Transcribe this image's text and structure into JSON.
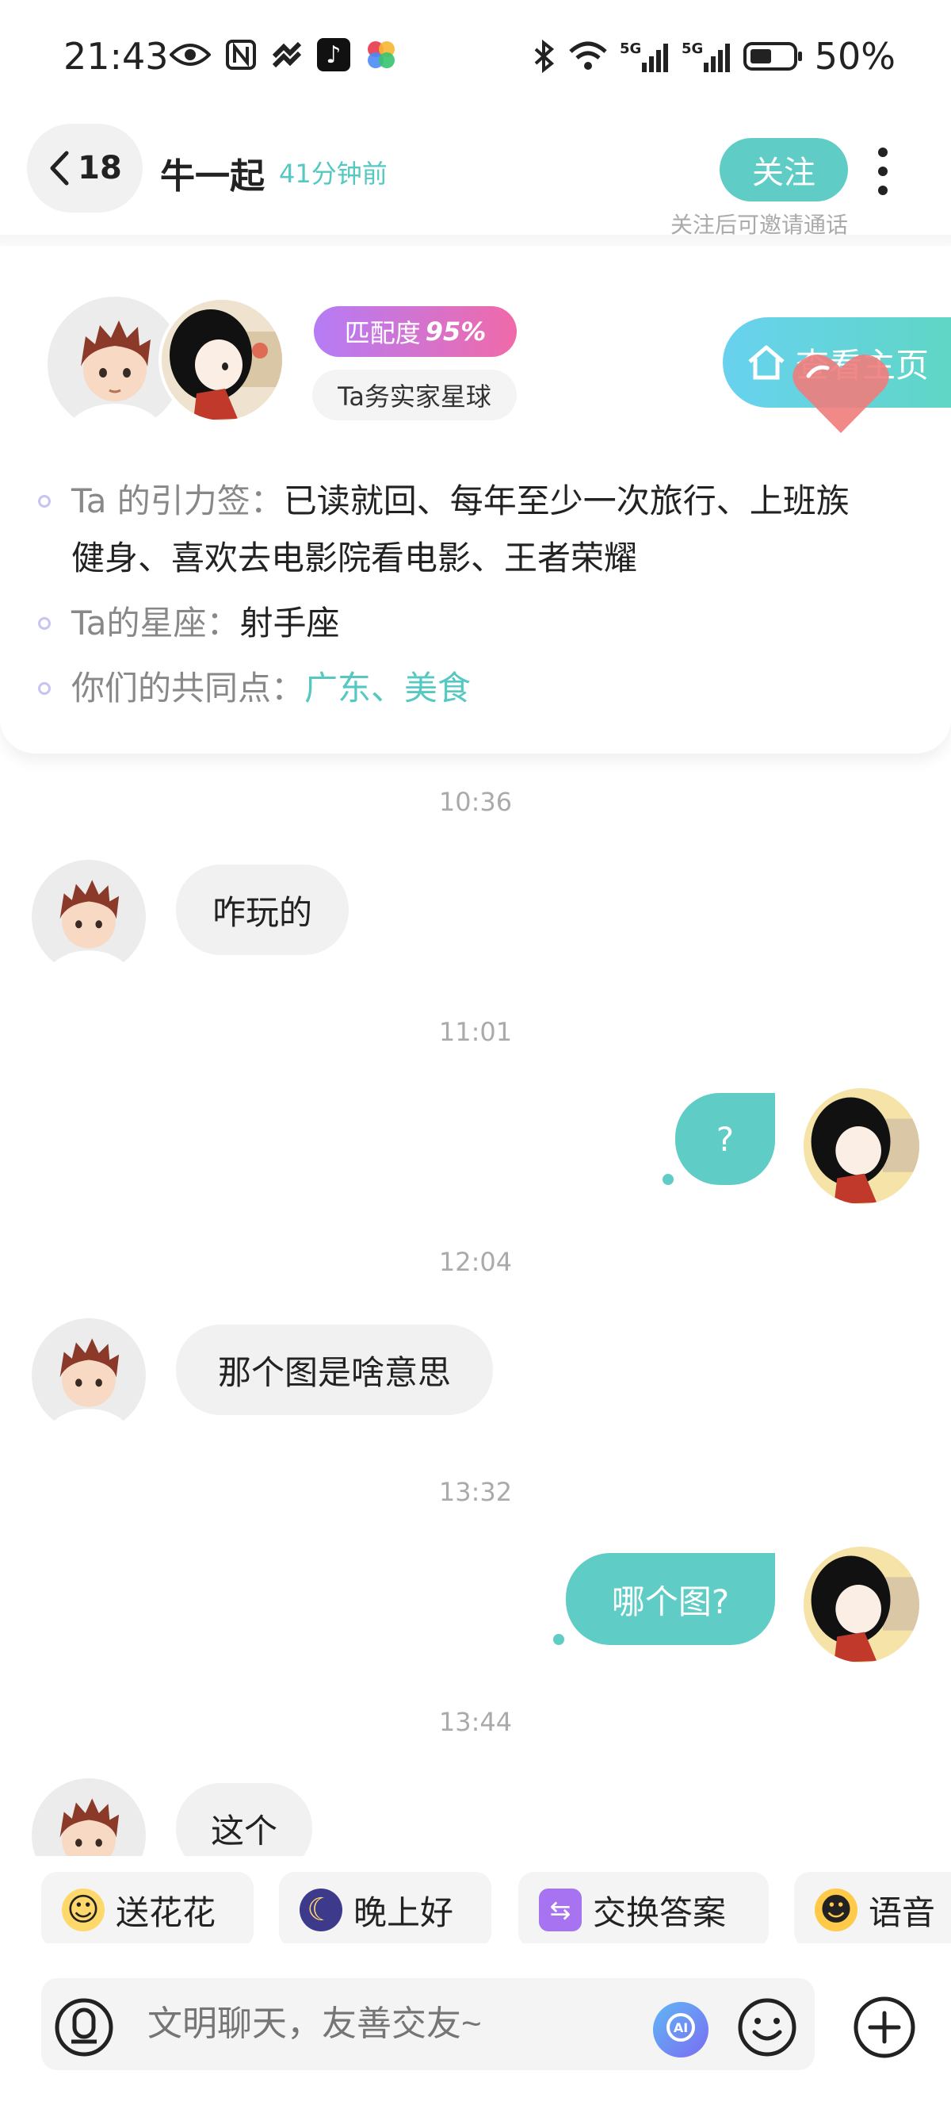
{
  "status_bar": {
    "time": "21:43",
    "battery": "50%",
    "icons": [
      "eye-icon",
      "nfc-icon",
      "signal-brand-icon",
      "tiktok-icon",
      "colorful-app-icon",
      "bluetooth-icon",
      "wifi-icon",
      "5g-signal-icon",
      "5g-signal-icon",
      "battery-icon"
    ]
  },
  "header": {
    "back_count": "18",
    "name": "牛一起",
    "last_seen": "41分钟前",
    "follow_label": "关注",
    "follow_hint": "关注后可邀请通话"
  },
  "profile": {
    "match_label": "匹配度",
    "match_value": "95%",
    "planet_tag": "Ta务实家星球",
    "homepage_label": "查看主页",
    "tags_label": "Ta 的引力签：",
    "tags_line1": "已读就回、每年至少一次旅行、上班族",
    "tags_line2": "健身、喜欢去电影院看电影、王者荣耀",
    "zodiac_label": "Ta的星座：",
    "zodiac_value": "射手座",
    "common_label": "你们的共同点：",
    "common_value": "广东、美食"
  },
  "messages": [
    {
      "time": "10:36",
      "from": "them",
      "text": "咋玩的"
    },
    {
      "time": "11:01",
      "from": "me",
      "text": "?"
    },
    {
      "time": "12:04",
      "from": "them",
      "text": "那个图是啥意思"
    },
    {
      "time": "13:32",
      "from": "me",
      "text": "哪个图?"
    },
    {
      "time": "13:44",
      "from": "them",
      "text": "这个"
    }
  ],
  "quick_replies": [
    {
      "label": "送花花",
      "icon": "flower-face-icon"
    },
    {
      "label": "晚上好",
      "icon": "moon-icon"
    },
    {
      "label": "交换答案",
      "icon": "swap-icon"
    },
    {
      "label": "语音",
      "icon": "smile-face-icon"
    }
  ],
  "input": {
    "placeholder": "文明聊天，友善交友~"
  },
  "colors": {
    "accent": "#5fcdc6",
    "match_gradient_start": "#b57cf6",
    "match_gradient_end": "#f06aa9"
  }
}
